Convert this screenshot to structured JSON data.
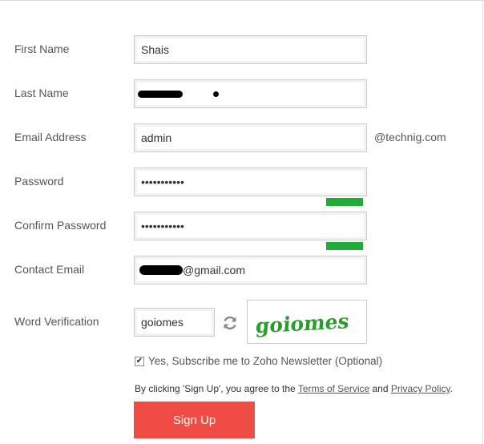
{
  "form": {
    "first_name": {
      "label": "First Name",
      "value": "Shais"
    },
    "last_name": {
      "label": "Last Name",
      "value": ""
    },
    "email_address": {
      "label": "Email Address",
      "value": "admin",
      "suffix": "@technig.com"
    },
    "password": {
      "label": "Password",
      "value": "•••••••••••",
      "strength_color": "#22aa3a"
    },
    "confirm_password": {
      "label": "Confirm Password",
      "value": "•••••••••••",
      "strength_color": "#22aa3a"
    },
    "contact_email": {
      "label": "Contact Email",
      "value_suffix": "@gmail.com"
    },
    "word_verification": {
      "label": "Word Verification",
      "value": "goiomes",
      "captcha_text": "goiomes",
      "captcha_color": "#2a9d2a"
    },
    "newsletter": {
      "checked": true,
      "label": "Yes, Subscribe me to Zoho Newsletter (Optional)"
    },
    "terms": {
      "prefix": "By clicking 'Sign Up', you agree to the ",
      "terms_link": "Terms of Service",
      "middle": " and ",
      "privacy_link": "Privacy Policy",
      "suffix": "."
    },
    "signup_button": {
      "label": "Sign Up",
      "color": "#ef4c45"
    }
  }
}
